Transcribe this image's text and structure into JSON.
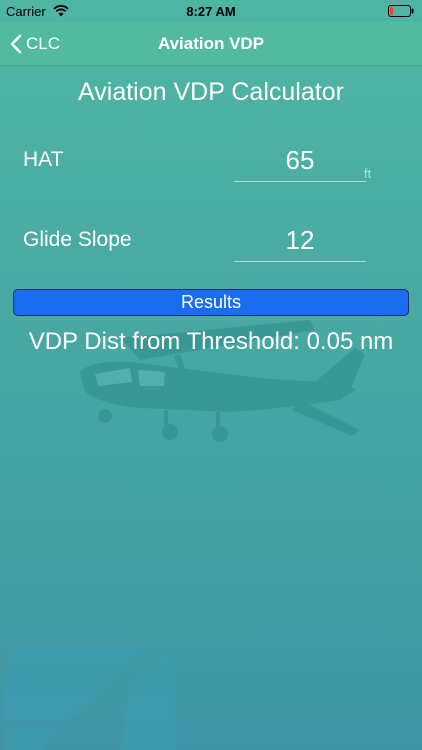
{
  "status_bar": {
    "carrier": "Carrier",
    "time": "8:27 AM",
    "wifi_icon": "wifi-icon",
    "battery_icon": "battery-low-icon"
  },
  "nav": {
    "back_label": "CLC",
    "back_icon": "chevron-left-icon",
    "title": "Aviation VDP"
  },
  "page": {
    "title": "Aviation VDP Calculator"
  },
  "form": {
    "hat_label": "HAT",
    "hat_value": "65",
    "hat_unit": "ft",
    "glide_slope_label": "Glide Slope",
    "glide_slope_value": "12"
  },
  "results": {
    "button_label": "Results",
    "output": "VDP Dist from Threshold: 0.05 nm"
  },
  "colors": {
    "background_top": "#4fb5a3",
    "background_bottom": "#3f95a6",
    "button_blue": "#1a6cf0",
    "battery_red": "#e8443a"
  }
}
